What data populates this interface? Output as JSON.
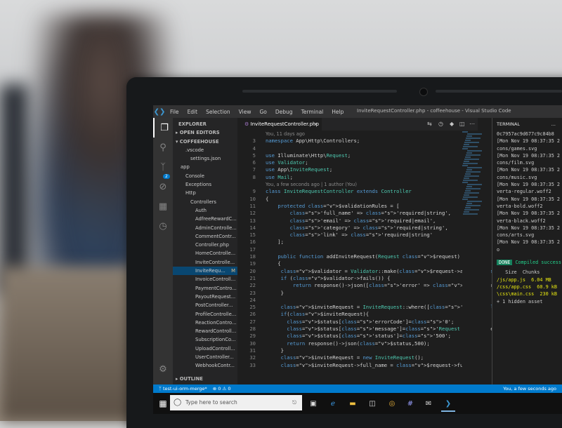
{
  "window": {
    "title": "InviteRequestController.php - coffeehouse - Visual Studio Code"
  },
  "menu": [
    "File",
    "Edit",
    "Selection",
    "View",
    "Go",
    "Debug",
    "Terminal",
    "Help"
  ],
  "activity": {
    "scm_badge": "2"
  },
  "sidebar": {
    "header": "EXPLORER",
    "open_editors": "OPEN EDITORS",
    "project": "COFFEEHOUSE",
    "items": [
      {
        "label": ".vscode",
        "indent": 2
      },
      {
        "label": "settings.json",
        "indent": 3
      },
      {
        "label": "app",
        "indent": 1
      },
      {
        "label": "Console",
        "indent": 2
      },
      {
        "label": "Exceptions",
        "indent": 2
      },
      {
        "label": "Http",
        "indent": 2
      },
      {
        "label": "Controllers",
        "indent": 3
      },
      {
        "label": "Auth",
        "indent": 4
      },
      {
        "label": "AdfreeRewardC...",
        "indent": 4
      },
      {
        "label": "AdminControlle...",
        "indent": 4
      },
      {
        "label": "CommentContr...",
        "indent": 4
      },
      {
        "label": "Controller.php",
        "indent": 4
      },
      {
        "label": "HomeControlle...",
        "indent": 4
      },
      {
        "label": "InviteControlle...",
        "indent": 4
      },
      {
        "label": "InviteRequ...",
        "indent": 4,
        "selected": true,
        "mark": "M"
      },
      {
        "label": "InvoiceControll...",
        "indent": 4
      },
      {
        "label": "PaymentContro...",
        "indent": 4
      },
      {
        "label": "PayoutRequest...",
        "indent": 4
      },
      {
        "label": "PostController...",
        "indent": 4
      },
      {
        "label": "ProfileControlle...",
        "indent": 4
      },
      {
        "label": "ReactionContro...",
        "indent": 4
      },
      {
        "label": "RewardControll...",
        "indent": 4
      },
      {
        "label": "SubscriptionCo...",
        "indent": 4
      },
      {
        "label": "UploadControll...",
        "indent": 4
      },
      {
        "label": "UserController...",
        "indent": 4
      },
      {
        "label": "WebhookContr...",
        "indent": 4
      }
    ],
    "outline": "OUTLINE"
  },
  "tab": {
    "label": "InviteRequestController.php"
  },
  "editor": {
    "blame_top": "You, 11 days ago",
    "blame_class": "You, a few seconds ago | 1 author (You)",
    "lines": [
      {
        "n": "3",
        "code": "namespace App\\Http\\Controllers;"
      },
      {
        "n": "4",
        "code": ""
      },
      {
        "n": "5",
        "code": "use Illuminate\\Http\\Request;"
      },
      {
        "n": "6",
        "code": "use Validator;"
      },
      {
        "n": "7",
        "code": "use App\\InviteRequest;"
      },
      {
        "n": "8",
        "code": "use Mail;"
      },
      {
        "n": "9",
        "code": "class InviteRequestController extends Controller"
      },
      {
        "n": "10",
        "code": "{"
      },
      {
        "n": "11",
        "code": "    protected $validationRules = ["
      },
      {
        "n": "12",
        "code": "        'full_name' => 'required|string',"
      },
      {
        "n": "13",
        "code": "        'email' => 'required|email',"
      },
      {
        "n": "14",
        "code": "        'category' => 'required|string',"
      },
      {
        "n": "15",
        "code": "        'link' => 'required|string'"
      },
      {
        "n": "16",
        "code": "    ];"
      },
      {
        "n": "17",
        "code": ""
      },
      {
        "n": "18",
        "code": "    public function addInviteRequest(Request $request)"
      },
      {
        "n": "19",
        "code": "    {"
      },
      {
        "n": "20",
        "code": "     $validator = Validator::make($request->all(), $this->vali"
      },
      {
        "n": "21",
        "code": "     if ($validator->fails()) {"
      },
      {
        "n": "22",
        "code": "         return response()->json(['error' => $validator->error"
      },
      {
        "n": "23",
        "code": "     }"
      },
      {
        "n": "24",
        "code": ""
      },
      {
        "n": "25",
        "code": "     $inviteRequest = InviteRequest::where(['email'=>$request-"
      },
      {
        "n": "26",
        "code": "     if($inviteRequest){"
      },
      {
        "n": "27",
        "code": "       $status['errorCode']='0';"
      },
      {
        "n": "28",
        "code": "       $status['message']='Request already sent';"
      },
      {
        "n": "29",
        "code": "       $status['status']='500';"
      },
      {
        "n": "30",
        "code": "       return response()->json($status,500);"
      },
      {
        "n": "31",
        "code": "     }"
      },
      {
        "n": "32",
        "code": "     $inviteRequest = new InviteRequest();"
      },
      {
        "n": "33",
        "code": "     $inviteRequest->full_name = $request->full_name;"
      }
    ]
  },
  "terminal": {
    "title": "TERMINAL",
    "menu": "...",
    "lines": [
      "0c7957ac9d677c9c84b8",
      "[Mon Nov 19 08:37:35 2",
      "cons/games.svg",
      "[Mon Nov 19 08:37:35 2",
      "cons/film.svg",
      "[Mon Nov 19 08:37:35 2",
      "cons/music.svg",
      "[Mon Nov 19 08:37:35 2",
      "verta-regular.woff2",
      "[Mon Nov 19 08:37:35 2",
      "verta-bold.woff2",
      "[Mon Nov 19 08:37:35 2",
      "verta-black.woff2",
      "[Mon Nov 19 08:37:35 2",
      "cons/arts.svg",
      "[Mon Nov 19 08:37:35 2",
      "o"
    ],
    "done_label": "DONE",
    "compiled": "Compiled success",
    "asset_head": "   Size  Chunks",
    "assets": [
      "/js/app.js  6.04 MB",
      "/css/app.css  60.9 kB",
      "\\css\\main.css  230 kB"
    ],
    "hidden": "+ 1 hidden asset"
  },
  "status": {
    "branch": "test-ui-orm-merge*",
    "problems": "⊗ 0 ⚠ 0",
    "blame": "You, a few seconds ago"
  },
  "taskbar": {
    "search_placeholder": "Type here to search"
  }
}
